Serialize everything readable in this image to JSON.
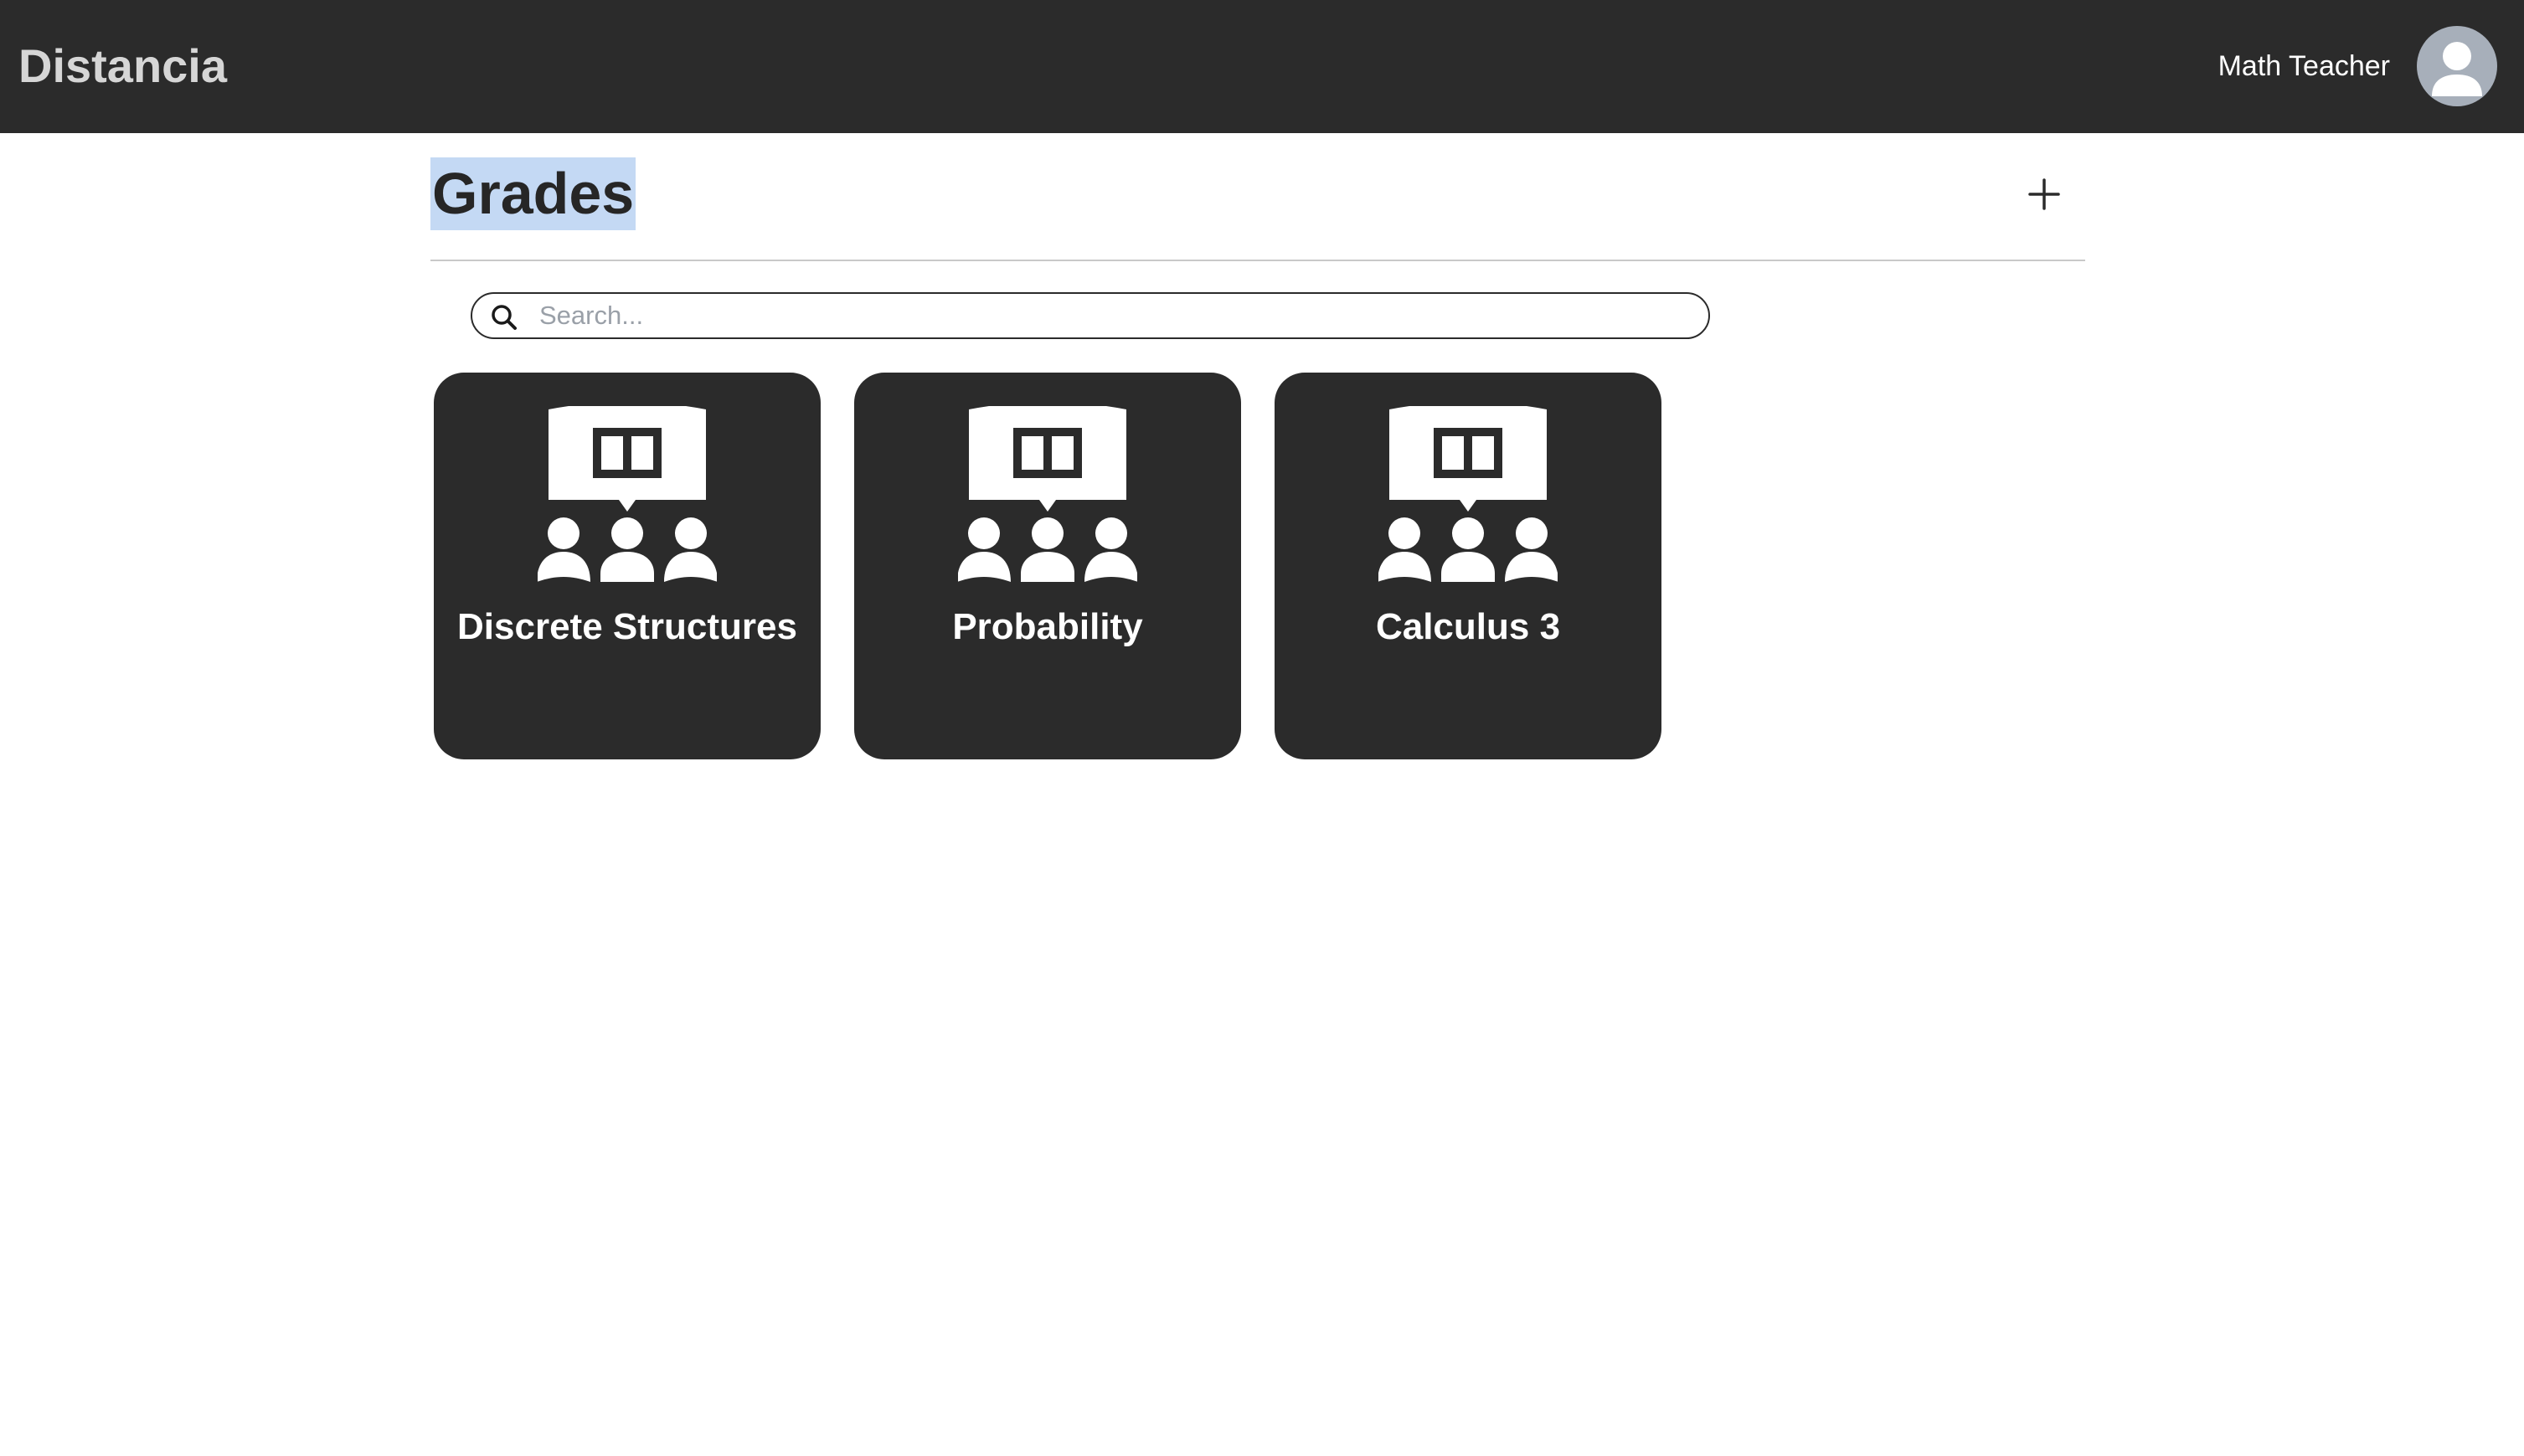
{
  "header": {
    "brand": "Distancia",
    "user_name": "Math Teacher"
  },
  "main": {
    "title": "Grades",
    "search": {
      "placeholder": "Search...",
      "value": ""
    },
    "classes": [
      {
        "name": "Discrete Structures"
      },
      {
        "name": "Probability"
      },
      {
        "name": "Calculus 3"
      }
    ]
  },
  "icons": {
    "add": "plus-icon",
    "search": "magnifier-icon",
    "avatar": "user-silhouette-icon",
    "class": "classroom-book-icon"
  },
  "colors": {
    "topbar": "#2b2b2b",
    "brand_text": "#d6d6d6",
    "card": "#2b2b2b",
    "title_highlight": "#c4d9f4",
    "avatar": "#a7afba"
  }
}
